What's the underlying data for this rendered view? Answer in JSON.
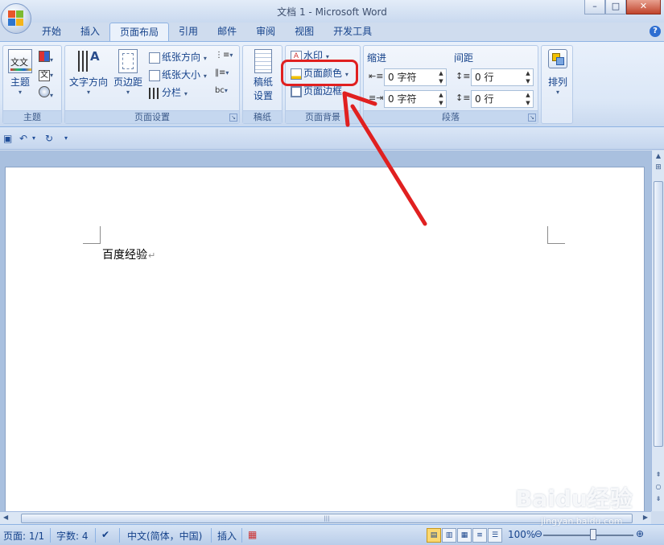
{
  "window": {
    "title": "文档 1 - Microsoft Word",
    "min_symbol": "–",
    "max_symbol": "□",
    "close_symbol": "✕"
  },
  "tabs": [
    {
      "label": "开始"
    },
    {
      "label": "插入"
    },
    {
      "label": "页面布局",
      "active": true
    },
    {
      "label": "引用"
    },
    {
      "label": "邮件"
    },
    {
      "label": "审阅"
    },
    {
      "label": "视图"
    },
    {
      "label": "开发工具"
    }
  ],
  "help_symbol": "?",
  "ribbon": {
    "theme_group": {
      "label": "主题",
      "theme_button": "主题",
      "theme_icon_text": "文文"
    },
    "page_setup": {
      "label": "页面设置",
      "text_direction": "文字方向",
      "margins": "页边距",
      "orientation": "纸张方向",
      "size": "纸张大小",
      "columns": "分栏"
    },
    "manuscript": {
      "label": "稿纸",
      "button_line1": "稿纸",
      "button_line2": "设置"
    },
    "page_background": {
      "label": "页面背景",
      "watermark": "水印",
      "page_color": "页面颜色",
      "page_borders": "页面边框"
    },
    "paragraph": {
      "label": "段落",
      "indent_label": "缩进",
      "spacing_label": "间距",
      "indent_left": "0 字符",
      "indent_right": "0 字符",
      "spacing_before": "0 行",
      "spacing_after": "0 行"
    },
    "arrange": {
      "button": "排列"
    }
  },
  "document": {
    "text": "百度经验",
    "para_mark": "↵"
  },
  "statusbar": {
    "page": "页面: 1/1",
    "words": "字数: 4",
    "language": "中文(简体，中国)",
    "mode": "插入",
    "zoom": "100%"
  },
  "watermark": {
    "text": "Baidu经验",
    "sub": "jingyan.baidu.com"
  },
  "colors": {
    "accent": "#15428b",
    "highlight": "#e02020"
  }
}
